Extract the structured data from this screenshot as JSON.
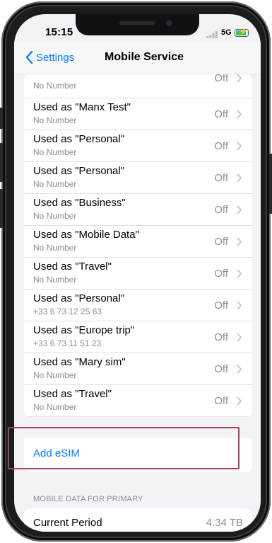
{
  "status": {
    "time": "15:15",
    "network": "5G"
  },
  "nav": {
    "back_label": "Settings",
    "title": "Mobile Service"
  },
  "rows": [
    {
      "title": "",
      "subtitle": "No Number",
      "value": "Off"
    },
    {
      "title": "Used as \"Manx Test\"",
      "subtitle": "No Number",
      "value": "Off"
    },
    {
      "title": "Used as \"Personal\"",
      "subtitle": "No Number",
      "value": "Off"
    },
    {
      "title": "Used as \"Personal\"",
      "subtitle": "No Number",
      "value": "Off"
    },
    {
      "title": "Used as \"Business\"",
      "subtitle": "No Number",
      "value": "Off"
    },
    {
      "title": "Used as \"Mobile Data\"",
      "subtitle": "No Number",
      "value": "Off"
    },
    {
      "title": "Used as \"Travel\"",
      "subtitle": "No Number",
      "value": "Off"
    },
    {
      "title": "Used as \"Personal\"",
      "subtitle": "+33 6 73 12 25 63",
      "value": "Off"
    },
    {
      "title": "Used as \"Europe trip\"",
      "subtitle": "+33 6 73 11 51 23",
      "value": "Off"
    },
    {
      "title": "Used as \"Mary sim\"",
      "subtitle": "No Number",
      "value": "Off"
    },
    {
      "title": "Used as \"Travel\"",
      "subtitle": "No Number",
      "value": "Off"
    }
  ],
  "add_esim": {
    "label": "Add eSIM"
  },
  "section_header": "MOBILE DATA FOR PRIMARY",
  "current_period": {
    "label": "Current Period",
    "value": "4.34 TB"
  },
  "colors": {
    "accent": "#0a7aff",
    "highlight": "#a7455a"
  }
}
